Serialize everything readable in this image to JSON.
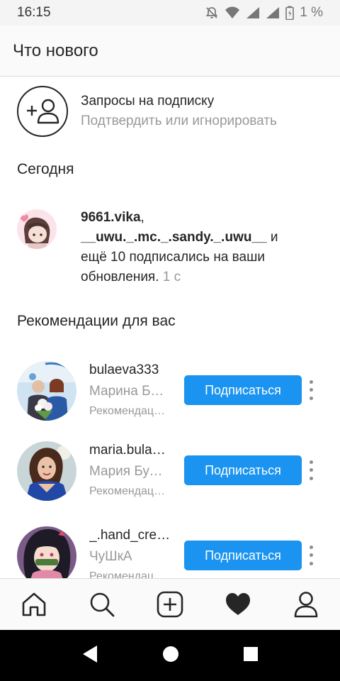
{
  "status_bar": {
    "time": "16:15",
    "battery_percent": "1 %",
    "icons": [
      "notifications-off-icon",
      "wifi-icon",
      "signal-icon",
      "signal-icon",
      "battery-icon"
    ]
  },
  "header": {
    "title": "Что нового"
  },
  "follow_requests": {
    "title": "Запросы на подписку",
    "subtitle": "Подтвердить или игнорировать",
    "icon": "add-person-icon"
  },
  "sections": {
    "today": "Сегодня",
    "suggestions": "Рекомендации для вас"
  },
  "activity": {
    "user1": "9661.vika",
    "separator": ",",
    "user2": "__uwu._.mc._.sandy._.uwu__",
    "text": " и ещё 10 подписались на ваши обновления.",
    "time": "1 с"
  },
  "suggestions": [
    {
      "username": "bulaeva333",
      "name": "Марина Булаева",
      "note": "Рекомендации для вас",
      "button": "Подписаться"
    },
    {
      "username": "maria.bulaeva",
      "name": "Мария Булаева",
      "note": "Рекомендации для вас",
      "button": "Подписаться"
    },
    {
      "username": "_.hand_creator",
      "name": "ЧуШкА",
      "note": "Рекомендации для вас",
      "button": "Подписаться"
    }
  ],
  "bottom_nav": [
    "home-icon",
    "search-icon",
    "new-post-icon",
    "activity-heart-icon",
    "profile-icon"
  ],
  "colors": {
    "accent": "#1a94f0",
    "muted_text": "#999999",
    "text": "#262626"
  }
}
